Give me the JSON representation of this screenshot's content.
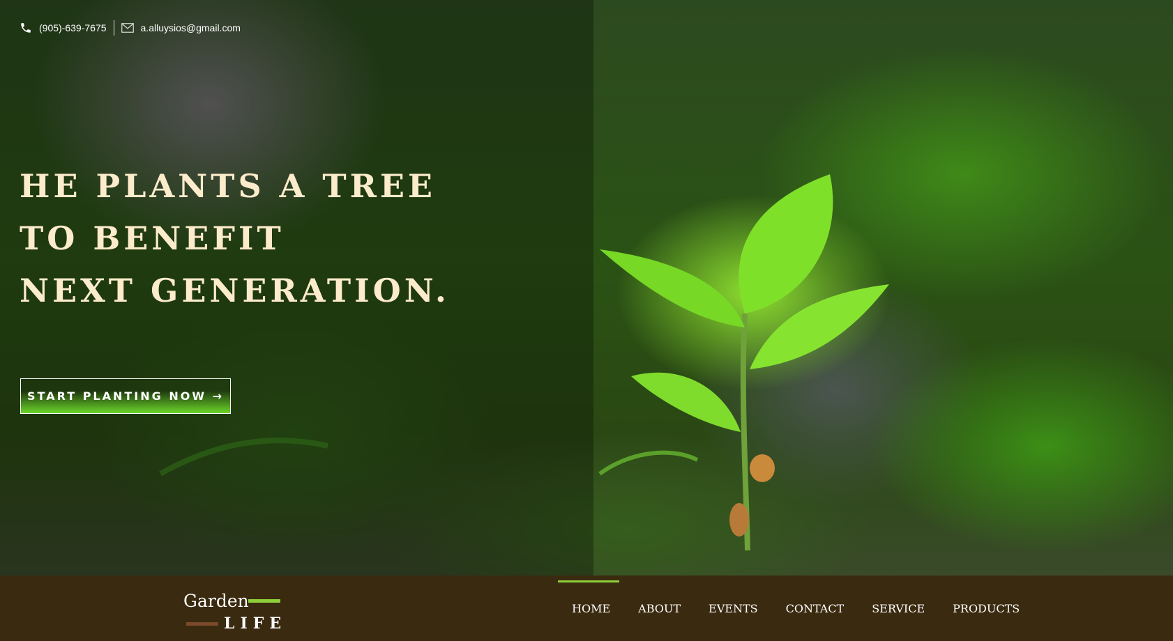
{
  "contact": {
    "phone_icon": "phone-icon",
    "phone": "(905)-639-7675",
    "email_icon": "envelope-icon",
    "email": "a.alluysios@gmail.com"
  },
  "hero": {
    "headline": [
      "HE PLANTS A TREE",
      "TO BENEFIT",
      "NEXT GENERATION."
    ],
    "cta_label": "START PLANTING NOW →"
  },
  "logo": {
    "word1": "Garden",
    "word2": "LIFE"
  },
  "nav": {
    "items": [
      "HOME",
      "ABOUT",
      "EVENTS",
      "CONTACT",
      "SERVICE",
      "PRODUCTS"
    ],
    "active": "HOME"
  },
  "colors": {
    "navbar_bg": "#3a2a10",
    "accent_green": "#8fd03a",
    "headline": "#fdeccb"
  }
}
